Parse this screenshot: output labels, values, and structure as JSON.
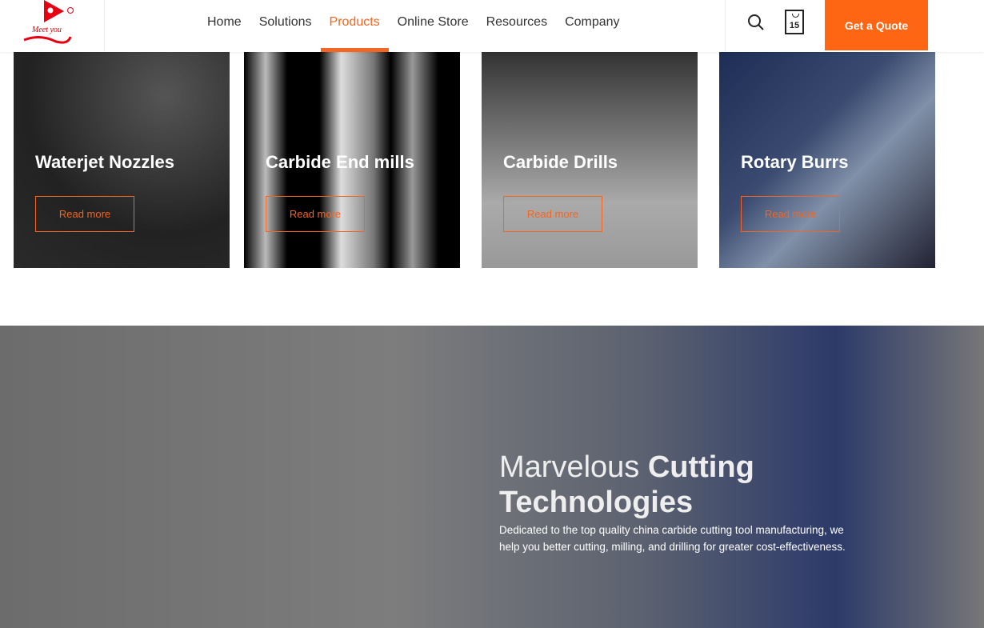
{
  "header": {
    "logo_text": "Meet you",
    "nav": [
      "Home",
      "Solutions",
      "Products",
      "Online Store",
      "Resources",
      "Company"
    ],
    "active": "Products",
    "calendar_day": "15",
    "quote_label": "Get a Quote"
  },
  "cards": [
    {
      "title": "Waterjet Nozzles",
      "button": "Read more"
    },
    {
      "title": "Carbide End mills",
      "button": "Read more"
    },
    {
      "title": "Carbide Drills",
      "button": "Read more"
    },
    {
      "title": "Rotary Burrs",
      "button": "Read more"
    }
  ],
  "hero": {
    "title_light": "Marvelous ",
    "title_bold1": "Cutting",
    "title_bold2": "Technologies",
    "description": "Dedicated to the top quality china carbide cutting tool manufacturing, we help you better cutting, milling, and drilling for greater cost-effectiveness."
  },
  "colors": {
    "accent": "#fe6614"
  }
}
